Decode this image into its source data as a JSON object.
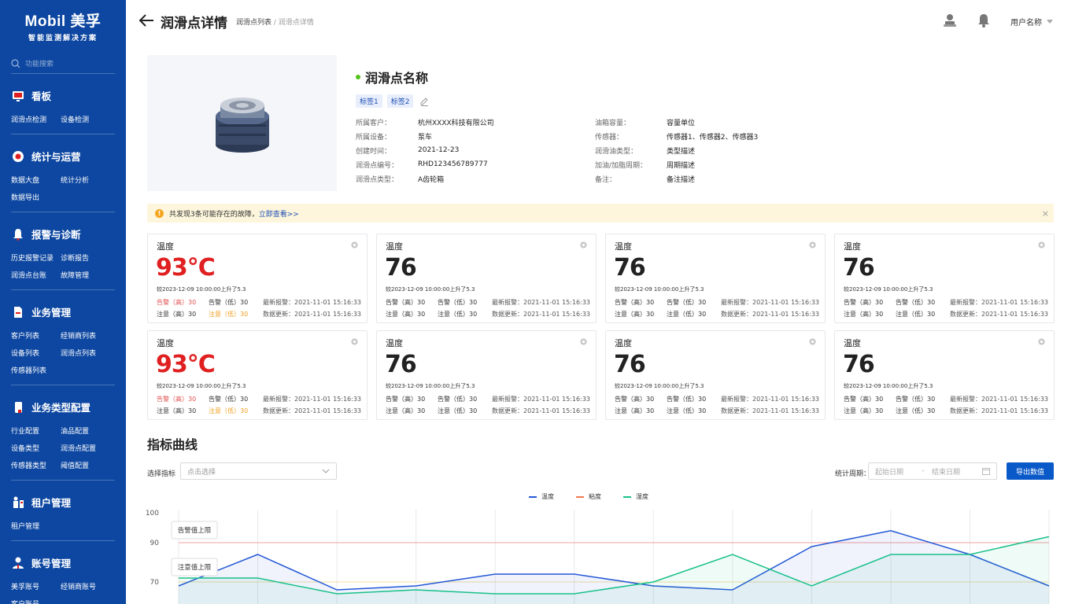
{
  "brand": {
    "logo": "Mobil 美孚",
    "subtitle": "智能监测解决方案"
  },
  "sidebar": {
    "search_placeholder": "功能搜索",
    "groups": [
      {
        "title": "看板",
        "icon": "monitor-icon",
        "items": [
          "润滑点检测",
          "设备检测"
        ]
      },
      {
        "title": "统计与运营",
        "icon": "chart-circle-icon",
        "items": [
          "数据大盘",
          "统计分析",
          "数据导出"
        ]
      },
      {
        "title": "报警与诊断",
        "icon": "bell-icon",
        "items": [
          "历史报警记录",
          "诊断报告",
          "润滑点台账",
          "故障管理"
        ]
      },
      {
        "title": "业务管理",
        "icon": "document-icon",
        "items": [
          "客户列表",
          "经销商列表",
          "设备列表",
          "润滑点列表",
          "传感器列表"
        ]
      },
      {
        "title": "业务类型配置",
        "icon": "phone-config-icon",
        "items": [
          "行业配置",
          "油品配置",
          "设备类型",
          "润滑点配置",
          "传感器类型",
          "阈值配置"
        ]
      },
      {
        "title": "租户管理",
        "icon": "tenant-icon",
        "items": [
          "租户管理"
        ]
      },
      {
        "title": "账号管理",
        "icon": "account-icon",
        "items": [
          "美孚账号",
          "经销商账号",
          "客户账号"
        ]
      }
    ]
  },
  "header": {
    "title": "润滑点详情",
    "breadcrumb": [
      "润滑点列表",
      "润滑点详情"
    ],
    "breadcrumb_sep": " / ",
    "username": "用户名称"
  },
  "detail": {
    "name": "润滑点名称",
    "tags": [
      "标签1",
      "标签2"
    ],
    "left": [
      {
        "k": "所属客户：",
        "v": "杭州XXXX科技有限公司"
      },
      {
        "k": "所属设备：",
        "v": "泵车"
      },
      {
        "k": "创建时间：",
        "v": "2021-12-23"
      },
      {
        "k": "润滑点编号：",
        "v": "RHD123456789777"
      },
      {
        "k": "润滑点类型：",
        "v": "A齿轮箱"
      }
    ],
    "right": [
      {
        "k": "油箱容量：",
        "v": "容量单位"
      },
      {
        "k": "传感器：",
        "v": "传感器1、传感器2、传感器3"
      },
      {
        "k": "润滑油类型：",
        "v": "类型描述"
      },
      {
        "k": "加油/加脂周期：",
        "v": "周期描述"
      },
      {
        "k": "备注：",
        "v": "备注描述"
      }
    ]
  },
  "alert": {
    "icon": "!",
    "text": "共发现3条可能存在的故障，",
    "link": "立即查看>>",
    "close": "×"
  },
  "cards": [
    {
      "title": "温度",
      "value": "93°C",
      "alarm": true
    },
    {
      "title": "温度",
      "value": "76",
      "alarm": false
    },
    {
      "title": "温度",
      "value": "76",
      "alarm": false
    },
    {
      "title": "温度",
      "value": "76",
      "alarm": false
    },
    {
      "title": "温度",
      "value": "93°C",
      "alarm": true
    },
    {
      "title": "温度",
      "value": "76",
      "alarm": false
    },
    {
      "title": "温度",
      "value": "76",
      "alarm": false
    },
    {
      "title": "温度",
      "value": "76",
      "alarm": false
    }
  ],
  "card_common": {
    "delta": "较2023-12-09 10:00:00上升了5.3",
    "warn_high": "告警（高）30",
    "warn_low": "告警（低）30",
    "latest_alarm": "最新报警：2021-11-01 15:16:33",
    "caution_high": "注意（高）30",
    "caution_low": "注意（低）30",
    "data_update": "数据更新：2021-11-01 15:16:33"
  },
  "curve": {
    "title": "指标曲线",
    "select_label": "选择指标",
    "select_placeholder": "点击选择",
    "period_label": "统计周期：",
    "start_placeholder": "起始日期",
    "range_sep": "-",
    "end_placeholder": "结束日期",
    "export_label": "导出数值"
  },
  "chart_data": {
    "type": "line",
    "legend": [
      "温度",
      "粘度",
      "湿度"
    ],
    "colors": {
      "温度": "#2458d6",
      "粘度": "#f07850",
      "湿度": "#19c08a",
      "alarm_line": "#f2a0a0",
      "caution_line": "#f0e0a0"
    },
    "y_ticks": [
      100,
      90,
      70
    ],
    "threshold_labels": [
      "告警值上限",
      "注意值上限"
    ],
    "thresholds": {
      "alarm_upper": 90,
      "caution_upper": 70
    },
    "series": [
      {
        "name": "温度",
        "values": [
          68,
          84,
          66,
          68,
          74,
          74,
          68,
          66,
          88,
          94,
          84,
          68
        ]
      },
      {
        "name": "湿度",
        "values": [
          72,
          72,
          64,
          66,
          64,
          64,
          70,
          84,
          68,
          84,
          84,
          92
        ]
      }
    ]
  }
}
